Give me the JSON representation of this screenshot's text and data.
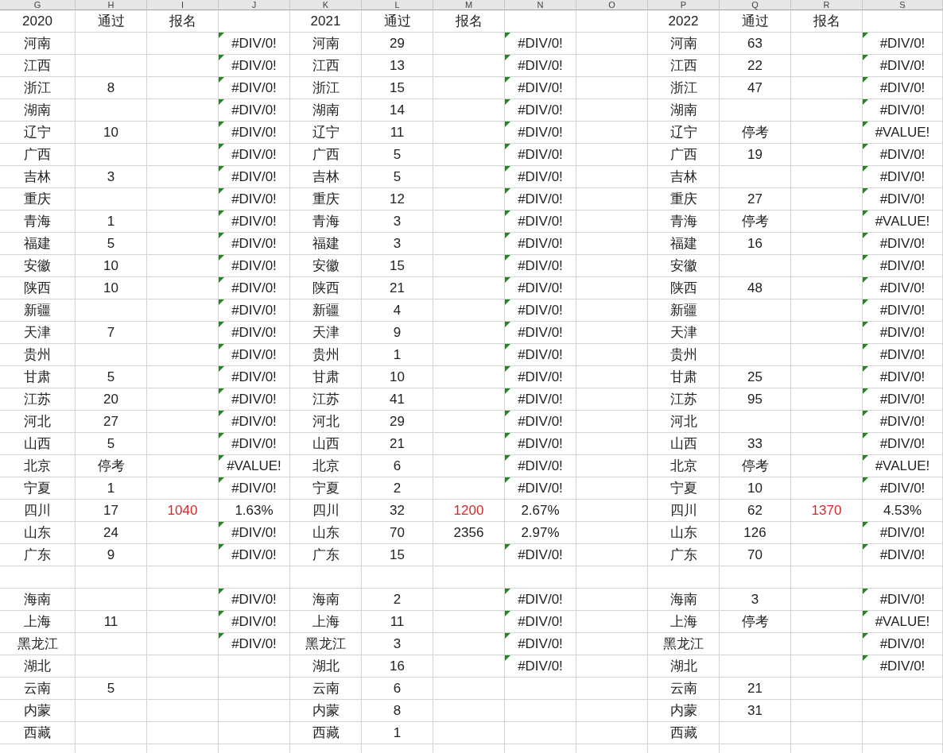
{
  "column_letters": [
    "G",
    "H",
    "I",
    "J",
    "K",
    "L",
    "M",
    "N",
    "O",
    "P",
    "Q",
    "R",
    "S"
  ],
  "blocks": [
    {
      "year": "2020",
      "passed_label": "通过",
      "signup_label": "报名",
      "groups": [
        [
          {
            "province": "河南",
            "ratio": "#DIV/0!",
            "flagged": true
          },
          {
            "province": "江西",
            "ratio": "#DIV/0!",
            "flagged": true
          },
          {
            "province": "浙江",
            "passed": "8",
            "ratio": "#DIV/0!",
            "flagged": true
          },
          {
            "province": "湖南",
            "ratio": "#DIV/0!",
            "flagged": true
          },
          {
            "province": "辽宁",
            "passed": "10",
            "ratio": "#DIV/0!",
            "flagged": true
          },
          {
            "province": "广西",
            "ratio": "#DIV/0!",
            "flagged": true
          },
          {
            "province": "吉林",
            "passed": "3",
            "ratio": "#DIV/0!",
            "flagged": true
          },
          {
            "province": "重庆",
            "ratio": "#DIV/0!",
            "flagged": true
          },
          {
            "province": "青海",
            "passed": "1",
            "ratio": "#DIV/0!",
            "flagged": true
          },
          {
            "province": "福建",
            "passed": "5",
            "ratio": "#DIV/0!",
            "flagged": true
          },
          {
            "province": "安徽",
            "passed": "10",
            "ratio": "#DIV/0!",
            "flagged": true
          },
          {
            "province": "陕西",
            "passed": "10",
            "ratio": "#DIV/0!",
            "flagged": true
          },
          {
            "province": "新疆",
            "ratio": "#DIV/0!",
            "flagged": true
          },
          {
            "province": "天津",
            "passed": "7",
            "ratio": "#DIV/0!",
            "flagged": true
          },
          {
            "province": "贵州",
            "ratio": "#DIV/0!",
            "flagged": true
          },
          {
            "province": "甘肃",
            "passed": "5",
            "ratio": "#DIV/0!",
            "flagged": true
          },
          {
            "province": "江苏",
            "passed": "20",
            "ratio": "#DIV/0!",
            "flagged": true
          },
          {
            "province": "河北",
            "passed": "27",
            "ratio": "#DIV/0!",
            "flagged": true
          },
          {
            "province": "山西",
            "passed": "5",
            "ratio": "#DIV/0!",
            "flagged": true
          },
          {
            "province": "北京",
            "passed": "停考",
            "ratio": "#VALUE!",
            "flagged": true
          },
          {
            "province": "宁夏",
            "passed": "1",
            "ratio": "#DIV/0!",
            "flagged": true
          },
          {
            "province": "四川",
            "passed": "17",
            "signup": {
              "text": "1040",
              "color": "#d42a2a"
            },
            "ratio": "1.63%",
            "flagged": false
          },
          {
            "province": "山东",
            "passed": "24",
            "ratio": "#DIV/0!",
            "flagged": true
          },
          {
            "province": "广东",
            "passed": "9",
            "ratio": "#DIV/0!",
            "flagged": true
          }
        ],
        [
          {
            "province": "海南",
            "ratio": "#DIV/0!",
            "flagged": true
          },
          {
            "province": "上海",
            "passed": "11",
            "ratio": "#DIV/0!",
            "flagged": true
          },
          {
            "province": "黑龙江",
            "ratio": "#DIV/0!",
            "flagged": true
          },
          {
            "province": "湖北"
          },
          {
            "province": "云南",
            "passed": "5"
          },
          {
            "province": "内蒙"
          },
          {
            "province": "西藏"
          }
        ]
      ]
    },
    {
      "year": "2021",
      "passed_label": "通过",
      "signup_label": "报名",
      "groups": [
        [
          {
            "province": "河南",
            "passed": "29",
            "ratio": "#DIV/0!",
            "flagged": true
          },
          {
            "province": "江西",
            "passed": "13",
            "ratio": "#DIV/0!",
            "flagged": true
          },
          {
            "province": "浙江",
            "passed": "15",
            "ratio": "#DIV/0!",
            "flagged": true
          },
          {
            "province": "湖南",
            "passed": "14",
            "ratio": "#DIV/0!",
            "flagged": true
          },
          {
            "province": "辽宁",
            "passed": "11",
            "ratio": "#DIV/0!",
            "flagged": true
          },
          {
            "province": "广西",
            "passed": "5",
            "ratio": "#DIV/0!",
            "flagged": true
          },
          {
            "province": "吉林",
            "passed": "5",
            "ratio": "#DIV/0!",
            "flagged": true
          },
          {
            "province": "重庆",
            "passed": "12",
            "ratio": "#DIV/0!",
            "flagged": true
          },
          {
            "province": "青海",
            "passed": "3",
            "ratio": "#DIV/0!",
            "flagged": true
          },
          {
            "province": "福建",
            "passed": "3",
            "ratio": "#DIV/0!",
            "flagged": true
          },
          {
            "province": "安徽",
            "passed": "15",
            "ratio": "#DIV/0!",
            "flagged": true
          },
          {
            "province": "陕西",
            "passed": "21",
            "ratio": "#DIV/0!",
            "flagged": true
          },
          {
            "province": "新疆",
            "passed": "4",
            "ratio": "#DIV/0!",
            "flagged": true
          },
          {
            "province": "天津",
            "passed": "9",
            "ratio": "#DIV/0!",
            "flagged": true
          },
          {
            "province": "贵州",
            "passed": "1",
            "ratio": "#DIV/0!",
            "flagged": true
          },
          {
            "province": "甘肃",
            "passed": "10",
            "ratio": "#DIV/0!",
            "flagged": true
          },
          {
            "province": "江苏",
            "passed": "41",
            "ratio": "#DIV/0!",
            "flagged": true
          },
          {
            "province": "河北",
            "passed": "29",
            "ratio": "#DIV/0!",
            "flagged": true
          },
          {
            "province": "山西",
            "passed": "21",
            "ratio": "#DIV/0!",
            "flagged": true
          },
          {
            "province": "北京",
            "passed": "6",
            "ratio": "#DIV/0!",
            "flagged": true
          },
          {
            "province": "宁夏",
            "passed": "2",
            "ratio": "#DIV/0!",
            "flagged": true
          },
          {
            "province": "四川",
            "passed": "32",
            "signup": {
              "text": "1200",
              "color": "#d42a2a"
            },
            "ratio": "2.67%",
            "flagged": false
          },
          {
            "province": "山东",
            "passed": "70",
            "signup": {
              "text": "2356",
              "color": "#222222"
            },
            "ratio": "2.97%",
            "flagged": false
          },
          {
            "province": "广东",
            "passed": "15",
            "ratio": "#DIV/0!",
            "flagged": true
          }
        ],
        [
          {
            "province": "海南",
            "passed": "2",
            "ratio": "#DIV/0!",
            "flagged": true
          },
          {
            "province": "上海",
            "passed": "11",
            "ratio": "#DIV/0!",
            "flagged": true
          },
          {
            "province": "黑龙江",
            "passed": "3",
            "ratio": "#DIV/0!",
            "flagged": true
          },
          {
            "province": "湖北",
            "passed": "16",
            "ratio": "#DIV/0!",
            "flagged": true
          },
          {
            "province": "云南",
            "passed": "6"
          },
          {
            "province": "内蒙",
            "passed": "8"
          },
          {
            "province": "西藏",
            "passed": "1"
          }
        ]
      ]
    },
    {
      "year": "2022",
      "passed_label": "通过",
      "signup_label": "报名",
      "groups": [
        [
          {
            "province": "河南",
            "passed": "63",
            "ratio": "#DIV/0!",
            "flagged": true
          },
          {
            "province": "江西",
            "passed": "22",
            "ratio": "#DIV/0!",
            "flagged": true
          },
          {
            "province": "浙江",
            "passed": "47",
            "ratio": "#DIV/0!",
            "flagged": true
          },
          {
            "province": "湖南",
            "ratio": "#DIV/0!",
            "flagged": true
          },
          {
            "province": "辽宁",
            "passed": "停考",
            "ratio": "#VALUE!",
            "flagged": true
          },
          {
            "province": "广西",
            "passed": "19",
            "ratio": "#DIV/0!",
            "flagged": true
          },
          {
            "province": "吉林",
            "ratio": "#DIV/0!",
            "flagged": true
          },
          {
            "province": "重庆",
            "passed": "27",
            "ratio": "#DIV/0!",
            "flagged": true
          },
          {
            "province": "青海",
            "passed": "停考",
            "ratio": "#VALUE!",
            "flagged": true
          },
          {
            "province": "福建",
            "passed": "16",
            "ratio": "#DIV/0!",
            "flagged": true
          },
          {
            "province": "安徽",
            "ratio": "#DIV/0!",
            "flagged": true
          },
          {
            "province": "陕西",
            "passed": "48",
            "ratio": "#DIV/0!",
            "flagged": true
          },
          {
            "province": "新疆",
            "ratio": "#DIV/0!",
            "flagged": true
          },
          {
            "province": "天津",
            "ratio": "#DIV/0!",
            "flagged": true
          },
          {
            "province": "贵州",
            "ratio": "#DIV/0!",
            "flagged": true
          },
          {
            "province": "甘肃",
            "passed": "25",
            "ratio": "#DIV/0!",
            "flagged": true
          },
          {
            "province": "江苏",
            "passed": "95",
            "ratio": "#DIV/0!",
            "flagged": true
          },
          {
            "province": "河北",
            "ratio": "#DIV/0!",
            "flagged": true
          },
          {
            "province": "山西",
            "passed": "33",
            "ratio": "#DIV/0!",
            "flagged": true
          },
          {
            "province": "北京",
            "passed": "停考",
            "ratio": "#VALUE!",
            "flagged": true
          },
          {
            "province": "宁夏",
            "passed": "10",
            "ratio": "#DIV/0!",
            "flagged": true
          },
          {
            "province": "四川",
            "passed": "62",
            "signup": {
              "text": "1370",
              "color": "#d42a2a"
            },
            "ratio": "4.53%",
            "flagged": false
          },
          {
            "province": "山东",
            "passed": "126",
            "ratio": "#DIV/0!",
            "flagged": true
          },
          {
            "province": "广东",
            "passed": "70",
            "ratio": "#DIV/0!",
            "flagged": true
          }
        ],
        [
          {
            "province": "海南",
            "passed": "3",
            "ratio": "#DIV/0!",
            "flagged": true
          },
          {
            "province": "上海",
            "passed": "停考",
            "ratio": "#VALUE!",
            "flagged": true
          },
          {
            "province": "黑龙江",
            "ratio": "#DIV/0!",
            "flagged": true
          },
          {
            "province": "湖北",
            "ratio": "#DIV/0!",
            "flagged": true
          },
          {
            "province": "云南",
            "passed": "21"
          },
          {
            "province": "内蒙",
            "passed": "31"
          },
          {
            "province": "西藏"
          }
        ]
      ]
    }
  ]
}
